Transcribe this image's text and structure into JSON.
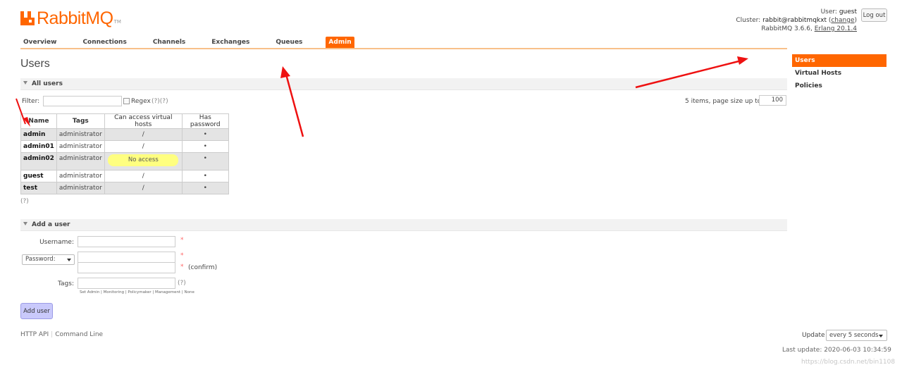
{
  "logo": {
    "text": "RabbitMQ",
    "tm": "TM"
  },
  "header": {
    "user_label": "User:",
    "user_value": "guest",
    "cluster_label": "Cluster:",
    "cluster_value": "rabbit@rabbitmqkxt",
    "change_link": "change",
    "version": "RabbitMQ 3.6.6,",
    "erlang": "Erlang 20.1.4",
    "logout_label": "Log out"
  },
  "nav": {
    "tabs": [
      "Overview",
      "Connections",
      "Channels",
      "Exchanges",
      "Queues",
      "Admin"
    ],
    "active": "Admin"
  },
  "page_title": "Users",
  "all_users": {
    "section_title": "All users",
    "filter_label": "Filter:",
    "regex_label": "Regex",
    "regex_help": "(?)(?)",
    "items_text": "5 items, page size up to",
    "page_size": "100",
    "columns": [
      "Name",
      "Tags",
      "Can access virtual hosts",
      "Has password"
    ],
    "rows": [
      {
        "name": "admin",
        "tags": "administrator",
        "vhosts": "/",
        "has_password": "•"
      },
      {
        "name": "admin01",
        "tags": "administrator",
        "vhosts": "/",
        "has_password": "•"
      },
      {
        "name": "admin02",
        "tags": "administrator",
        "vhosts": "No access",
        "has_password": "•"
      },
      {
        "name": "guest",
        "tags": "administrator",
        "vhosts": "/",
        "has_password": "•"
      },
      {
        "name": "test",
        "tags": "administrator",
        "vhosts": "/",
        "has_password": "•"
      }
    ],
    "help": "(?)"
  },
  "add_user": {
    "section_title": "Add a user",
    "username_label": "Username:",
    "password_select": "Password:",
    "confirm_label": "(confirm)",
    "tags_label": "Tags:",
    "tags_help": "(?)",
    "required_mark": "*",
    "tag_hints": "Set  Admin | Monitoring | Policymaker | Management | None",
    "button_label": "Add user"
  },
  "footer": {
    "http_api": "HTTP API",
    "command_line": "Command Line",
    "update_label": "Update",
    "update_value": "every 5 seconds",
    "last_update": "Last update: 2020-06-03 10:34:59",
    "watermark": "https://blog.csdn.net/bin1108"
  },
  "sidebar": {
    "items": [
      "Users",
      "Virtual Hosts",
      "Policies"
    ],
    "active": "Users"
  },
  "colors": {
    "accent": "#ff6600",
    "no_access": "#ffff80",
    "button": "#c9c9fb",
    "annotation": "#ee1111"
  }
}
